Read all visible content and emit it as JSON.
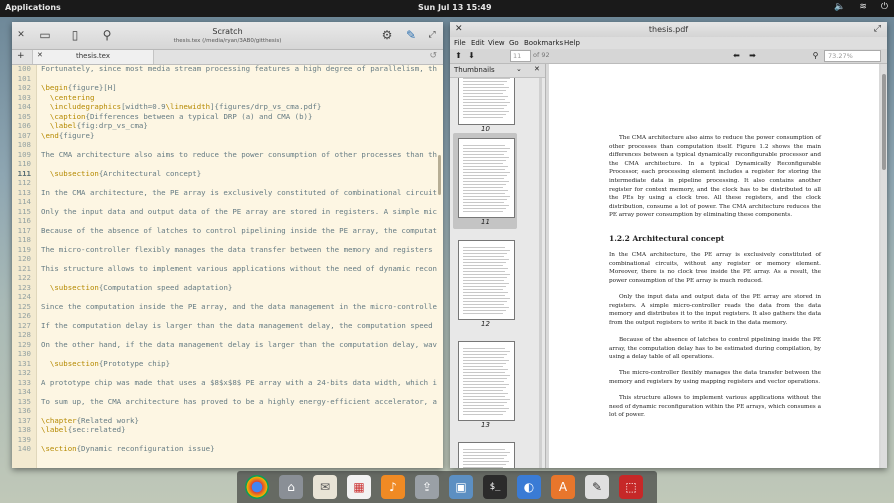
{
  "panel": {
    "applications": "Applications",
    "clock": "Sun Jul 13  15:49"
  },
  "scratch": {
    "title": "Scratch",
    "path": "thesis.tex (/media/ryan/3AB0/gitthesis)",
    "tab_label": "thesis.tex",
    "lines": [
      {
        "n": "100",
        "c": "Fortunately, since most media stream processing features a high degree of parallelism, th"
      },
      {
        "n": "101",
        "c": ""
      },
      {
        "n": "102",
        "c": "\\begin{figure}[H]"
      },
      {
        "n": "103",
        "c": "  \\centering"
      },
      {
        "n": "104",
        "c": "  \\includegraphics[width=0.9\\linewidth]{figures/drp_vs_cma.pdf}"
      },
      {
        "n": "105",
        "c": "  \\caption{Differences between a typical DRP (a) and CMA (b)}"
      },
      {
        "n": "106",
        "c": "  \\label{fig:drp_vs_cma}"
      },
      {
        "n": "107",
        "c": "\\end{figure}"
      },
      {
        "n": "108",
        "c": ""
      },
      {
        "n": "109",
        "c": "The CMA architecture also aims to reduce the power consumption of other processes than th"
      },
      {
        "n": "110",
        "c": ""
      },
      {
        "n": "111",
        "c": "  \\subsection{Architectural concept}"
      },
      {
        "n": "112",
        "c": ""
      },
      {
        "n": "113",
        "c": "In the CMA architecture, the PE array is exclusively constituted of combinational circuit"
      },
      {
        "n": "114",
        "c": ""
      },
      {
        "n": "115",
        "c": "Only the input data and output data of the PE array are stored in registers. A simple mic"
      },
      {
        "n": "116",
        "c": ""
      },
      {
        "n": "117",
        "c": "Because of the absence of latches to control pipelining inside the PE array, the computat"
      },
      {
        "n": "118",
        "c": ""
      },
      {
        "n": "119",
        "c": "The micro-controller flexibly manages the data transfer between the memory and registers"
      },
      {
        "n": "120",
        "c": ""
      },
      {
        "n": "121",
        "c": "This structure allows to implement various applications without the need of dynamic recon"
      },
      {
        "n": "122",
        "c": ""
      },
      {
        "n": "123",
        "c": "  \\subsection{Computation speed adaptation}"
      },
      {
        "n": "124",
        "c": ""
      },
      {
        "n": "125",
        "c": "Since the computation inside the PE array, and the data management in the micro-controlle"
      },
      {
        "n": "126",
        "c": ""
      },
      {
        "n": "127",
        "c": "If the computation delay is larger than the data management delay, the computation speed"
      },
      {
        "n": "128",
        "c": ""
      },
      {
        "n": "129",
        "c": "On the other hand, if the data management delay is larger than the computation delay, wav"
      },
      {
        "n": "130",
        "c": ""
      },
      {
        "n": "131",
        "c": "  \\subsection{Prototype chip}"
      },
      {
        "n": "132",
        "c": ""
      },
      {
        "n": "133",
        "c": "A prototype chip was made that uses a $8$x$8$ PE array with a 24-bits data width, which i"
      },
      {
        "n": "134",
        "c": ""
      },
      {
        "n": "135",
        "c": "To sum up, the CMA architecture has proved to be a highly energy-efficient accelerator, a"
      },
      {
        "n": "136",
        "c": ""
      },
      {
        "n": "137",
        "c": "\\chapter{Related work}"
      },
      {
        "n": "138",
        "c": "\\label{sec:related}"
      },
      {
        "n": "139",
        "c": ""
      },
      {
        "n": "140",
        "c": "\\section{Dynamic reconfiguration issue}"
      }
    ]
  },
  "pdf": {
    "title": "thesis.pdf",
    "menu": [
      "File",
      "Edit",
      "View",
      "Go",
      "Bookmarks",
      "Help"
    ],
    "page_input": "11",
    "page_of": "of 92",
    "zoom": "73.27%",
    "sidebar_label": "Thumbnails",
    "thumb_numbers": [
      "10",
      "11",
      "12",
      "13"
    ],
    "paragraphs": [
      "The CMA architecture also aims to reduce the power consumption of other processes than computation itself. Figure 1.2 shows the main differences between a typical dynamically reconfigurable processor and the CMA architecture. In a typical Dynamically Reconfigurable Processor, each processing element includes a register for storing the intermediate data in pipeline processing. It also contains another register for context memory, and the clock has to be distributed to all the PEs by using a clock tree. All these registers, and the clock distribution, consume a lot of power. The CMA architecture reduces the PE array power consumption by eliminating these components.",
      "In the CMA architecture, the PE array is exclusively constituted of combinational circuits, without any register or memory element. Moreover, there is no clock tree inside the PE array. As a result, the power consumption of the PE array is much reduced.",
      "Only the input data and output data of the PE array are stored in registers. A simple micro-controller reads the data from the data memory and distributes it to the input registers. It also gathers the data from the output registers to write it back in the data memory.",
      "Because of the absence of latches to control pipelining inside the PE array, the computation delay has to be estimated during compilation, by using a delay table of all operations.",
      "The micro-controller flexibly manages the data transfer between the memory and registers by using mapping registers and vector operations.",
      "This structure allows to implement various applications without the need of dynamic reconfiguration within the PE arrays, which consumes a lot of power."
    ],
    "section_heading": "1.2.2   Architectural concept"
  },
  "dock": {
    "items": [
      "chrome-icon",
      "files-icon",
      "mail-icon",
      "calendar-icon",
      "music-icon",
      "mail-send-icon",
      "photos-icon",
      "terminal-icon",
      "switch-icon",
      "software-center-icon",
      "text-editor-icon",
      "pdf-viewer-icon"
    ]
  }
}
